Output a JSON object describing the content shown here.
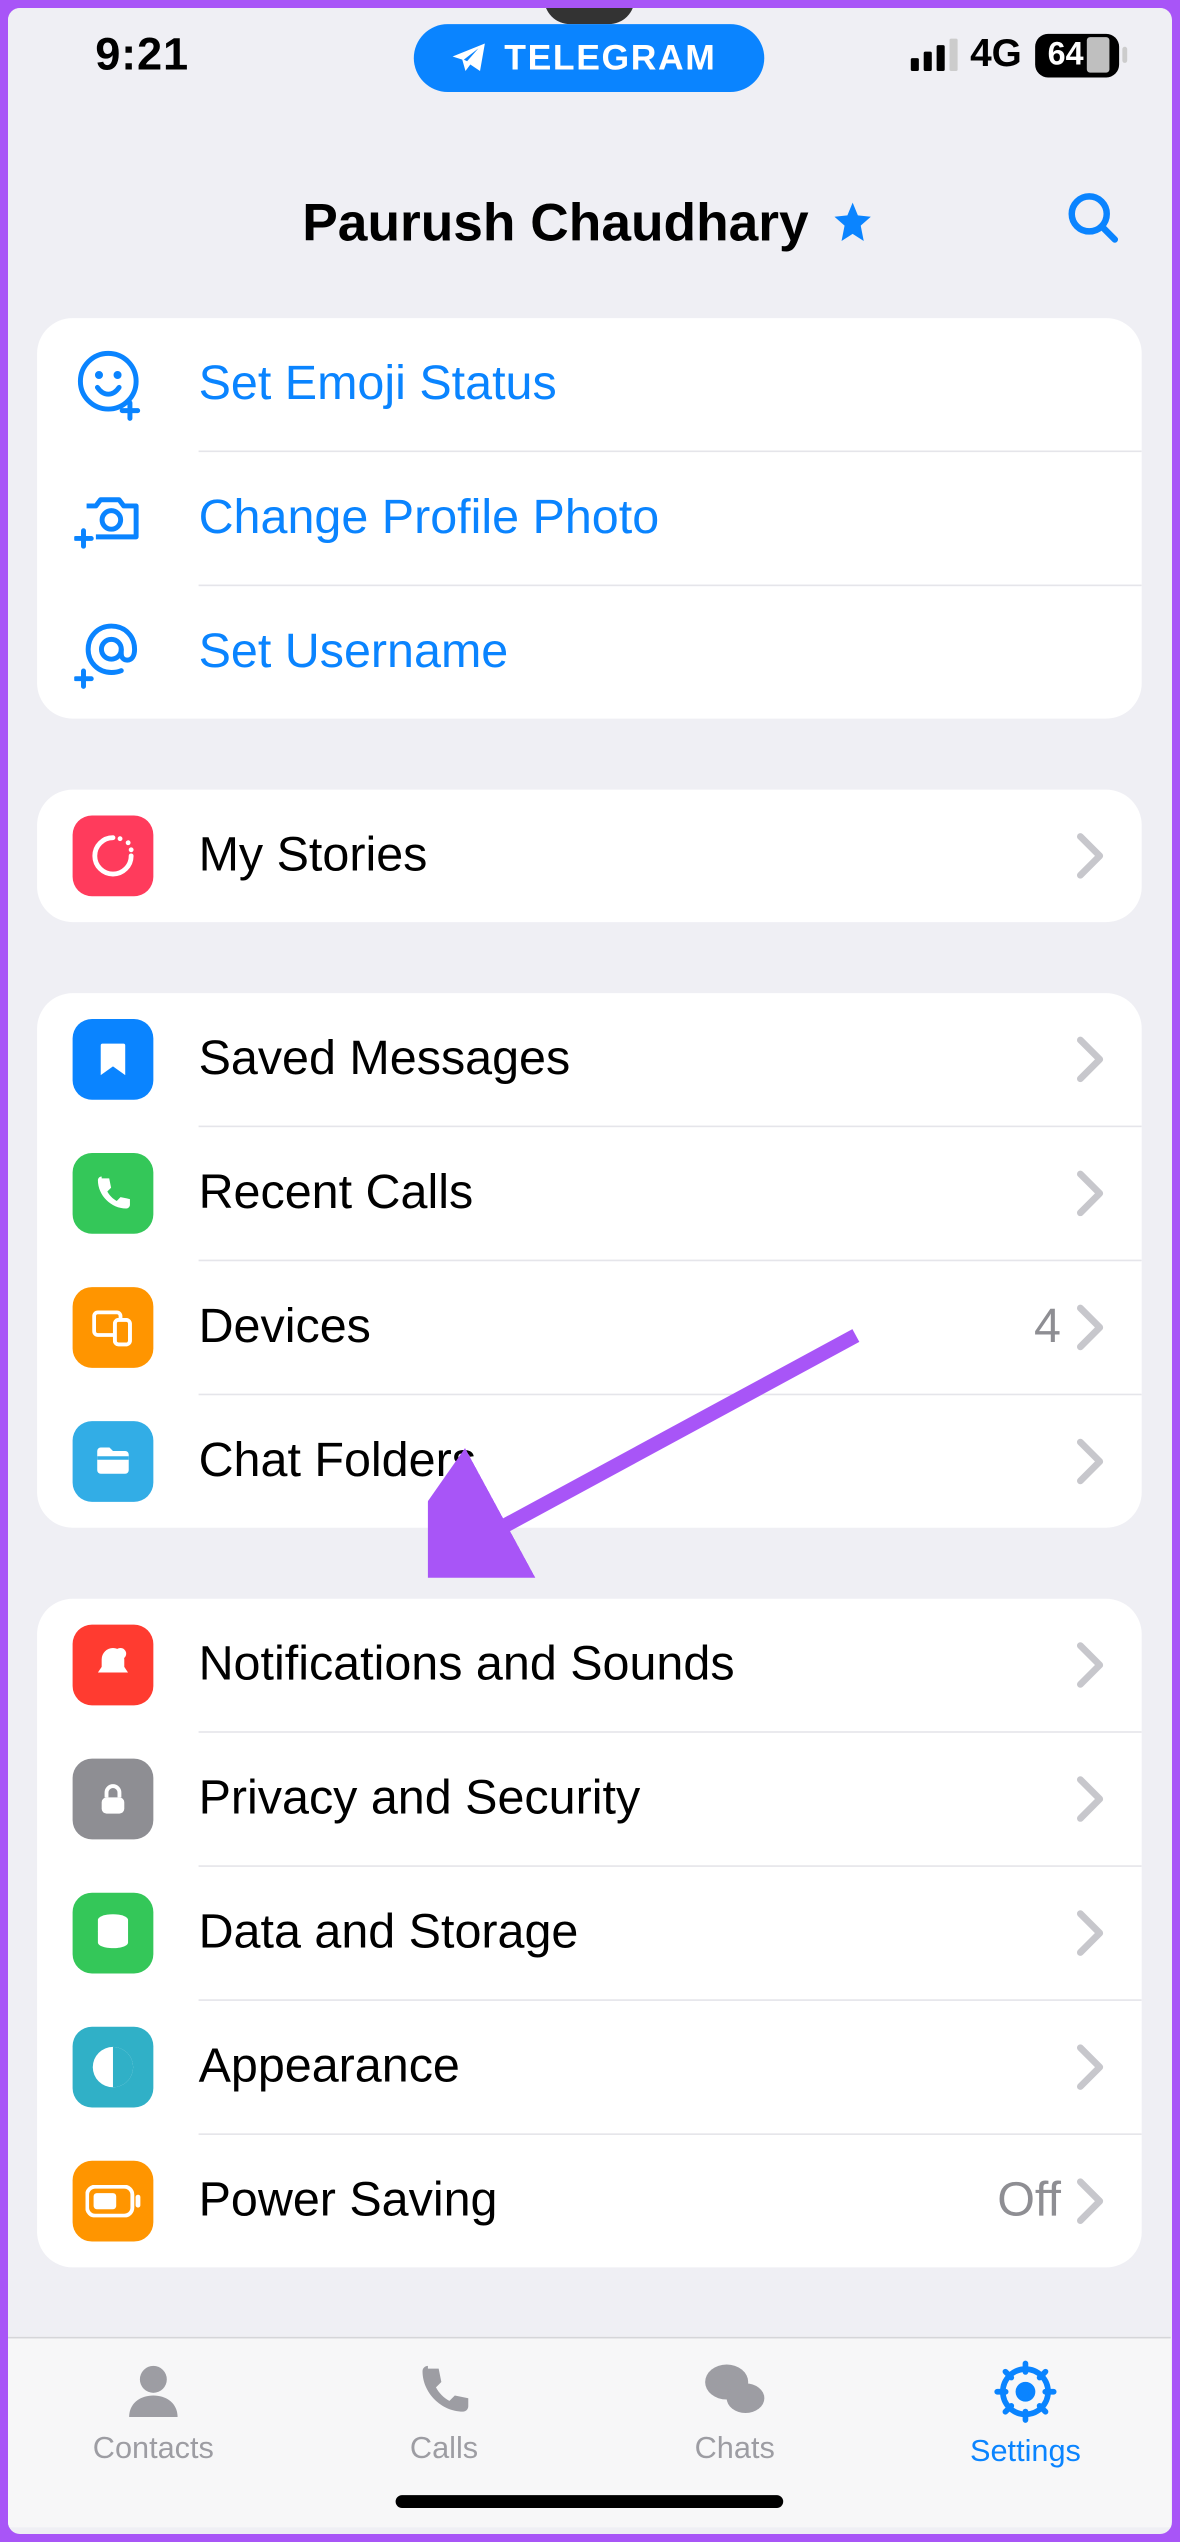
{
  "status": {
    "time": "9:21",
    "network": "4G",
    "battery": "64"
  },
  "app_pill": "TELEGRAM",
  "header": {
    "title": "Paurush Chaudhary"
  },
  "group1": {
    "emoji_status": "Set Emoji Status",
    "change_photo": "Change Profile Photo",
    "set_username": "Set Username"
  },
  "group2": {
    "my_stories": "My Stories"
  },
  "group3": {
    "saved_messages": "Saved Messages",
    "recent_calls": "Recent Calls",
    "devices": "Devices",
    "devices_count": "4",
    "chat_folders": "Chat Folders"
  },
  "group4": {
    "notifications": "Notifications and Sounds",
    "privacy": "Privacy and Security",
    "data": "Data and Storage",
    "appearance": "Appearance",
    "power_saving": "Power Saving",
    "power_saving_value": "Off"
  },
  "tabs": {
    "contacts": "Contacts",
    "calls": "Calls",
    "chats": "Chats",
    "settings": "Settings"
  }
}
